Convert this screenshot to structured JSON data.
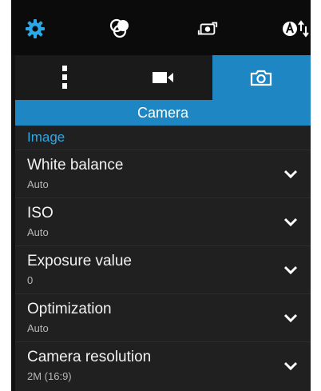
{
  "topbar": {
    "icons": [
      "gear-icon",
      "filter-effects-icon",
      "camera-switch-icon",
      "auto-mode-icon"
    ]
  },
  "tabs": [
    {
      "name": "more-options",
      "icon": "vertical-dots-icon",
      "active": false
    },
    {
      "name": "video",
      "icon": "video-camera-icon",
      "active": false
    },
    {
      "name": "camera",
      "icon": "camera-icon",
      "active": true
    }
  ],
  "section": {
    "title": "Camera"
  },
  "group": {
    "title": "Image"
  },
  "settings": [
    {
      "label": "White balance",
      "value": "Auto"
    },
    {
      "label": "ISO",
      "value": "Auto"
    },
    {
      "label": "Exposure value",
      "value": "0"
    },
    {
      "label": "Optimization",
      "value": "Auto"
    },
    {
      "label": "Camera resolution",
      "value": "2M (16:9)"
    }
  ],
  "colors": {
    "accent": "#1f86c4",
    "group_title": "#2fa9e6",
    "background": "#202020",
    "topbar": "#0b0b0b"
  }
}
